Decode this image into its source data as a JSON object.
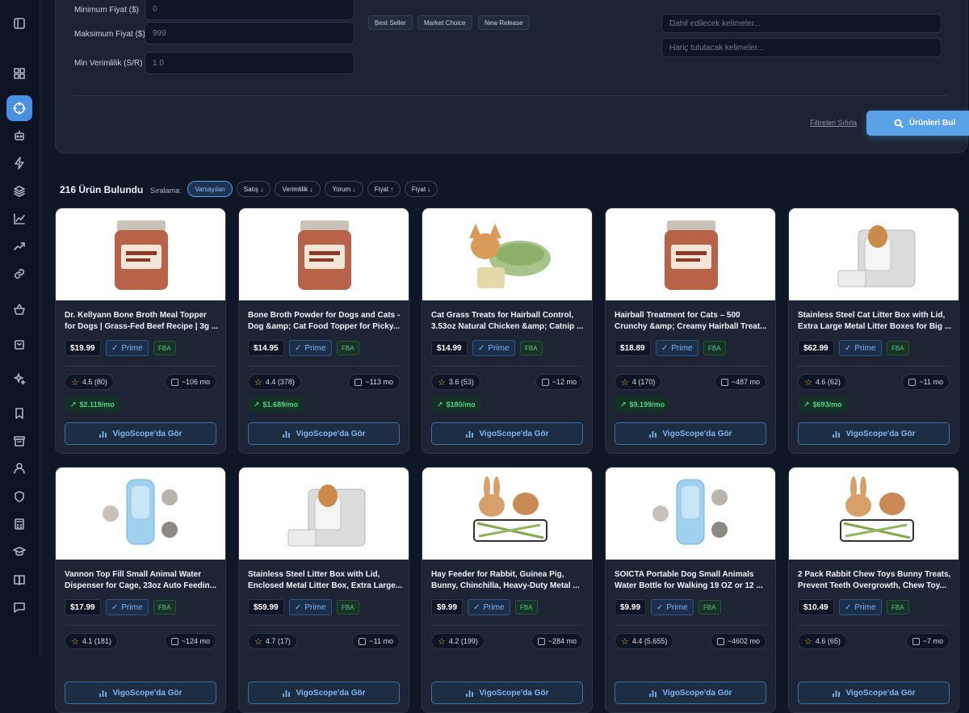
{
  "filters": {
    "min_price_label": "Minimum Fiyat ($)",
    "min_price_placeholder": "0",
    "max_price_label": "Maksimum Fiyat ($)",
    "max_price_placeholder": "999",
    "min_eff_label": "Min Verimlilik (S/R)",
    "min_eff_placeholder": "1.0",
    "badges": [
      "Best Seller",
      "Market Choice",
      "New Release"
    ],
    "include_placeholder": "Dahil edilecek kelimeler...",
    "exclude_placeholder": "Hariç tutulacak kelimeler...",
    "reset_label": "Filtreleri Sıfırla",
    "find_label": "Ürünleri Bul"
  },
  "results": {
    "count_label": "216 Ürün Bulundu",
    "sort_label": "Sıralama:",
    "sort_options": [
      "Varsayılan",
      "Satış ↓",
      "Verimlilik ↓",
      "Yorum ↓",
      "Fiyat ↑",
      "Fiyat ↓"
    ],
    "active_sort": "Varsayılan"
  },
  "card_labels": {
    "prime": "Prime",
    "fba": "FBA",
    "view_button": "VigoScope'da Gör"
  },
  "products": [
    {
      "title": "Dr. Kellyann Bone Broth Meal Topper for Dogs | Grass-Fed Beef Recipe | 3g ...",
      "price": "$19.99",
      "rating": "4.5 (80)",
      "months": "~106 mo",
      "revenue": "$2.119/mo",
      "icon": "jar-icon"
    },
    {
      "title": "Bone Broth Powder for Dogs and Cats - Dog &amp; Cat Food Topper for Picky...",
      "price": "$14.95",
      "rating": "4.4 (378)",
      "months": "~113 mo",
      "revenue": "$1.689/mo",
      "icon": "jar-icon"
    },
    {
      "title": "Cat Grass Treats for Hairball Control, 3.53oz Natural Chicken &amp; Catnip ...",
      "price": "$14.99",
      "rating": "3.6 (53)",
      "months": "~12 mo",
      "revenue": "$180/mo",
      "icon": "cat-icon"
    },
    {
      "title": "Hairball Treatment for Cats – 500 Crunchy &amp; Creamy Hairball Treat...",
      "price": "$18.89",
      "rating": "4 (170)",
      "months": "~487 mo",
      "revenue": "$9.199/mo",
      "icon": "jar-icon"
    },
    {
      "title": "Stainless Steel Cat Litter Box with Lid, Extra Large Metal Litter Boxes for Big ...",
      "price": "$62.99",
      "rating": "4.6 (62)",
      "months": "~11 mo",
      "revenue": "$693/mo",
      "icon": "box-icon"
    },
    {
      "title": "Vannon Top Fill Small Animal Water Dispenser for Cage, 23oz Auto Feedin...",
      "price": "$17.99",
      "rating": "4.1 (181)",
      "months": "~124 mo",
      "revenue": "",
      "icon": "bottle-icon"
    },
    {
      "title": "Stainless Steel Litter Box with Lid, Enclosed Metal Litter Box, Extra Large...",
      "price": "$59.99",
      "rating": "4.7 (17)",
      "months": "~11 mo",
      "revenue": "",
      "icon": "box-icon"
    },
    {
      "title": "Hay Feeder for Rabbit, Guinea Pig, Bunny, Chinchilla, Heavy-Duty Metal ...",
      "price": "$9.99",
      "rating": "4.2 (199)",
      "months": "~284 mo",
      "revenue": "",
      "icon": "rabbit-icon"
    },
    {
      "title": "SOICTA Portable Dog Small Animals Water Bottle for Walking 19 OZ or 12 ...",
      "price": "$9.99",
      "rating": "4.4 (5.655)",
      "months": "~4602 mo",
      "revenue": "",
      "icon": "bottle-icon"
    },
    {
      "title": "2 Pack Rabbit Chew Toys Bunny Treats, Prevent Teeth Overgrowth, Chew Toy...",
      "price": "$10.49",
      "rating": "4.6 (65)",
      "months": "~7 mo",
      "revenue": "",
      "icon": "rabbit-icon"
    }
  ]
}
